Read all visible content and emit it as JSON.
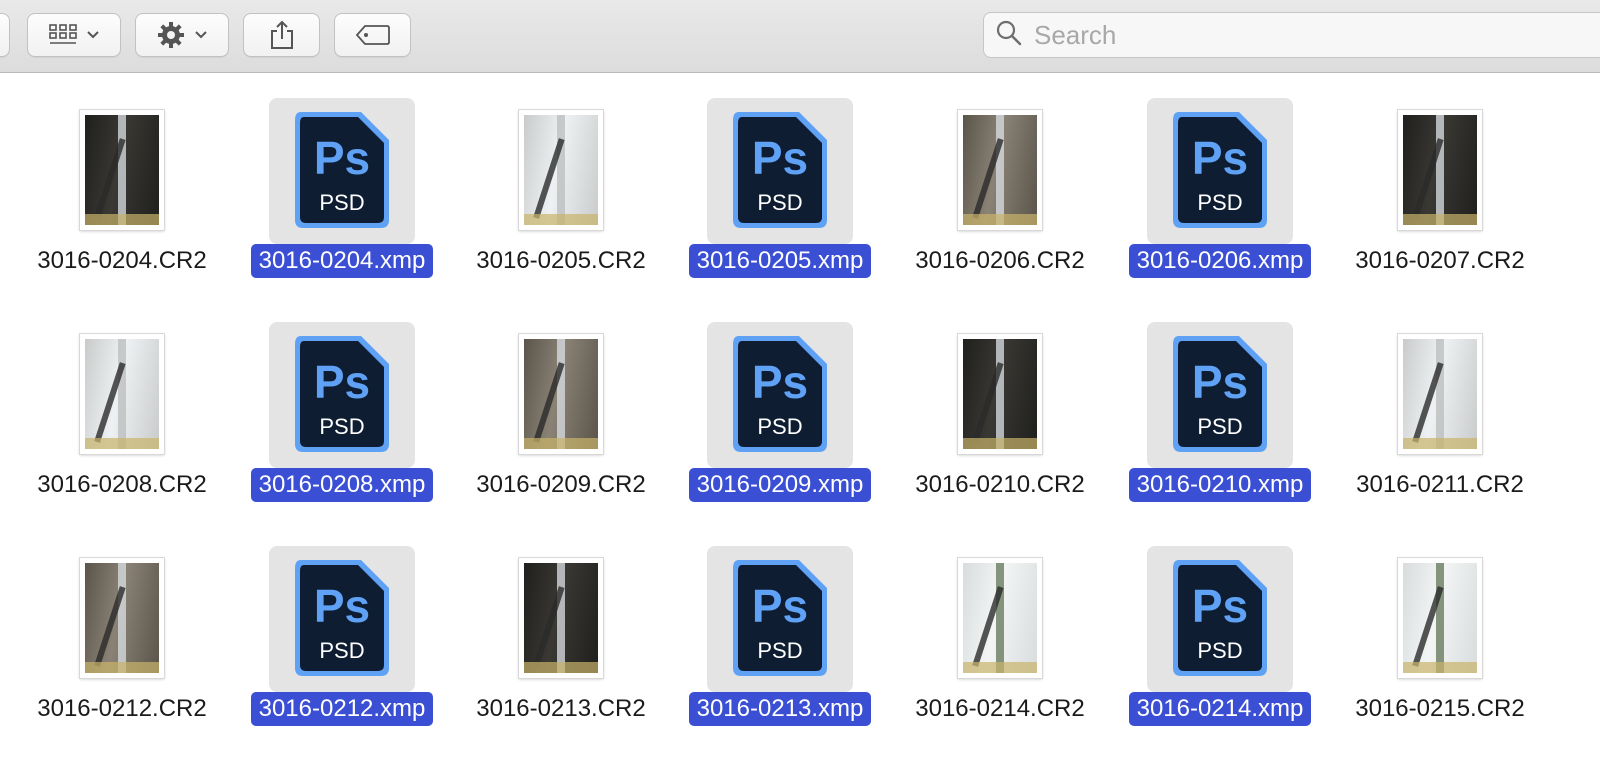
{
  "toolbar": {
    "buttons": [
      {
        "name": "view-options",
        "icon": "grid-icon",
        "has_menu": true
      },
      {
        "name": "action-menu",
        "icon": "gear-icon",
        "has_menu": true
      },
      {
        "name": "share",
        "icon": "share-icon"
      },
      {
        "name": "tags",
        "icon": "tag-icon"
      }
    ],
    "search_placeholder": "Search"
  },
  "colors": {
    "selection": "#3b4fd4",
    "psd_body": "#0f1d33",
    "psd_accent": "#5fa2f5"
  },
  "psd_icon": {
    "glyph": "Ps",
    "type": "PSD"
  },
  "files": [
    {
      "name": "3016-0204.CR2",
      "kind": "cr2",
      "selected": false,
      "tone": "dark"
    },
    {
      "name": "3016-0204.xmp",
      "kind": "psd",
      "selected": true
    },
    {
      "name": "3016-0205.CR2",
      "kind": "cr2",
      "selected": false,
      "tone": "light"
    },
    {
      "name": "3016-0205.xmp",
      "kind": "psd",
      "selected": true
    },
    {
      "name": "3016-0206.CR2",
      "kind": "cr2",
      "selected": false,
      "tone": "mid"
    },
    {
      "name": "3016-0206.xmp",
      "kind": "psd",
      "selected": true
    },
    {
      "name": "3016-0207.CR2",
      "kind": "cr2",
      "selected": false,
      "tone": "dark"
    },
    {
      "name": "3016-0208.CR2",
      "kind": "cr2",
      "selected": false,
      "tone": "light"
    },
    {
      "name": "3016-0208.xmp",
      "kind": "psd",
      "selected": true
    },
    {
      "name": "3016-0209.CR2",
      "kind": "cr2",
      "selected": false,
      "tone": "mid"
    },
    {
      "name": "3016-0209.xmp",
      "kind": "psd",
      "selected": true
    },
    {
      "name": "3016-0210.CR2",
      "kind": "cr2",
      "selected": false,
      "tone": "dark"
    },
    {
      "name": "3016-0210.xmp",
      "kind": "psd",
      "selected": true
    },
    {
      "name": "3016-0211.CR2",
      "kind": "cr2",
      "selected": false,
      "tone": "light"
    },
    {
      "name": "3016-0212.CR2",
      "kind": "cr2",
      "selected": false,
      "tone": "mid"
    },
    {
      "name": "3016-0212.xmp",
      "kind": "psd",
      "selected": true
    },
    {
      "name": "3016-0213.CR2",
      "kind": "cr2",
      "selected": false,
      "tone": "dark"
    },
    {
      "name": "3016-0213.xmp",
      "kind": "psd",
      "selected": true
    },
    {
      "name": "3016-0214.CR2",
      "kind": "cr2",
      "selected": false,
      "tone": "garden"
    },
    {
      "name": "3016-0214.xmp",
      "kind": "psd",
      "selected": true
    },
    {
      "name": "3016-0215.CR2",
      "kind": "cr2",
      "selected": false,
      "tone": "garden"
    }
  ]
}
